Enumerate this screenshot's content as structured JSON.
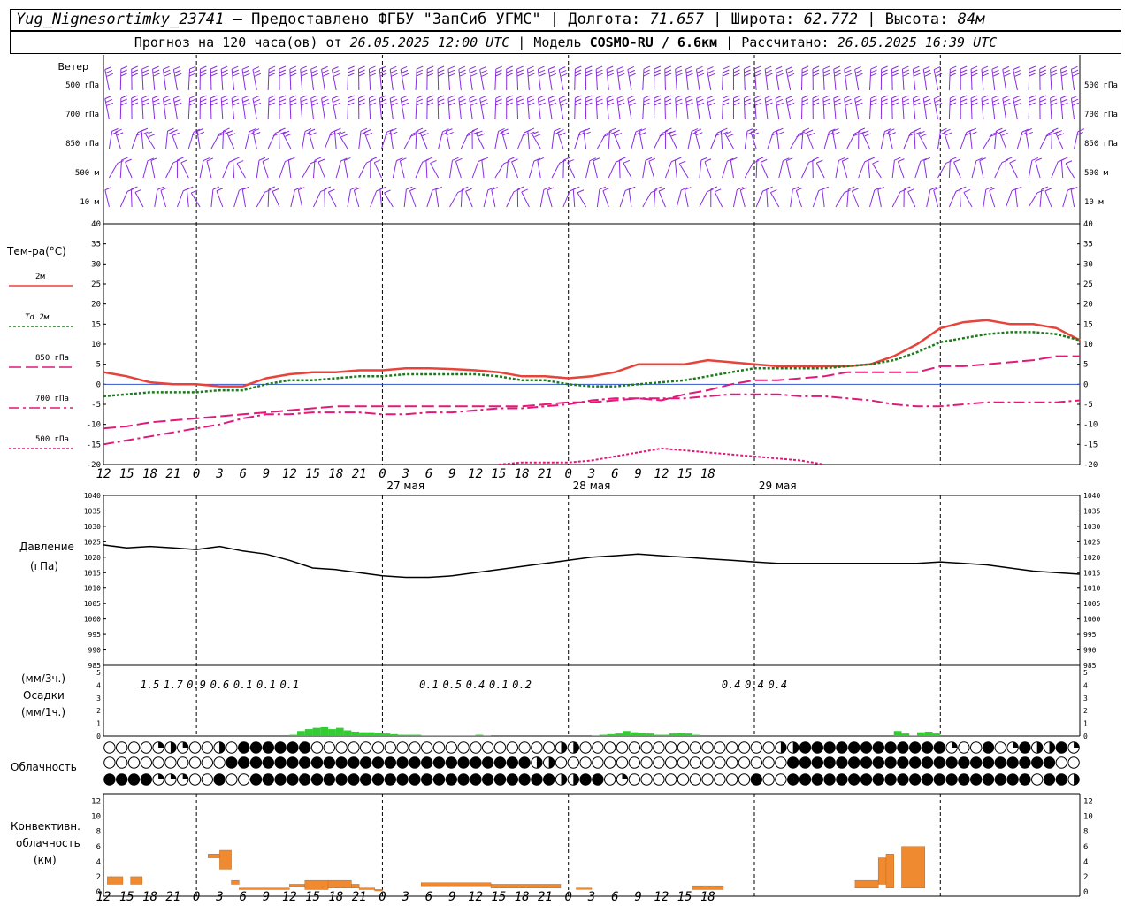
{
  "header": {
    "station": "Yug_Nignesortimky_23741",
    "provided": "– Предоставлено ФГБУ \"ЗапСиб УГМС\"",
    "lon_label": "Долгота:",
    "lon": "71.657",
    "lat_label": "Широта:",
    "lat": "62.772",
    "alt_label": "Высота:",
    "alt": "84м",
    "forecast_label": "Прогноз на 120 часа(ов) от",
    "forecast_from": "26.05.2025 12:00 UTC",
    "model_label": "Модель",
    "model": "COSMO-RU / 6.6км",
    "calc_label": "Рассчитано:",
    "calc": "26.05.2025 16:39 UTC"
  },
  "time_axis": {
    "hours": [
      "12",
      "15",
      "18",
      "21",
      "0",
      "3",
      "6",
      "9",
      "12",
      "15",
      "18",
      "21",
      "0",
      "3",
      "6",
      "9",
      "12",
      "15",
      "18",
      "21",
      "0",
      "3",
      "6",
      "9",
      "12",
      "15",
      "18"
    ],
    "days": [
      "27 мая",
      "28 мая",
      "29 мая"
    ]
  },
  "wind": {
    "label": "Ветер",
    "levels": [
      "500 гПа",
      "700 гПа",
      "850 гПа",
      "500 м",
      "10  м"
    ],
    "color": "#8a2be2"
  },
  "chart_data": [
    {
      "type": "line",
      "panel": "temperature",
      "label": "Тем-ра(°С)",
      "ylim": [
        -20,
        40
      ],
      "yticks": [
        -20,
        -15,
        -10,
        -5,
        0,
        5,
        10,
        15,
        20,
        25,
        30,
        35,
        40
      ],
      "x_hours": [
        0,
        3,
        6,
        9,
        12,
        15,
        18,
        21,
        24,
        27,
        30,
        33,
        36,
        39,
        42,
        45,
        48,
        51,
        54,
        57,
        60,
        63,
        66,
        69,
        72,
        75,
        78,
        81,
        84,
        87,
        90,
        93,
        96,
        99,
        102,
        105,
        108,
        111,
        114,
        117,
        120,
        123,
        126
      ],
      "series": [
        {
          "name": "2м",
          "color": "#e8433a",
          "style": "solid",
          "values": [
            3,
            2,
            0.5,
            0,
            0,
            -0.5,
            -0.5,
            1.5,
            2.5,
            3,
            3,
            3.5,
            3.5,
            4,
            4,
            3.8,
            3.5,
            3,
            2,
            2,
            1.5,
            2,
            3,
            5,
            5,
            5,
            6,
            5.5,
            5,
            4.5,
            4.5,
            4.5,
            4.5,
            5,
            7,
            10,
            14,
            15.5,
            16,
            15,
            15,
            14,
            11
          ]
        },
        {
          "name": "Td 2м",
          "color": "#1e7a1e",
          "style": "dotted",
          "values": [
            -3,
            -2.5,
            -2,
            -2,
            -2,
            -1.5,
            -1.5,
            0,
            1,
            1,
            1.5,
            2,
            2,
            2.5,
            2.5,
            2.5,
            2.5,
            2,
            1,
            1,
            0,
            -0.5,
            -0.5,
            0,
            0.5,
            1,
            2,
            3,
            4,
            4,
            4,
            4,
            4.5,
            5,
            6,
            8,
            10.5,
            11.5,
            12.5,
            13,
            13,
            12.5,
            11
          ]
        },
        {
          "name": "850 гПа",
          "color": "#e0197a",
          "style": "longdash",
          "values": [
            -11,
            -10.5,
            -9.5,
            -9,
            -8.5,
            -8,
            -7.5,
            -7,
            -6.5,
            -6,
            -5.5,
            -5.5,
            -5.5,
            -5.5,
            -5.5,
            -5.5,
            -5.5,
            -5.5,
            -5.5,
            -5,
            -4.5,
            -4.5,
            -4,
            -3.5,
            -4,
            -2.5,
            -1.5,
            0,
            1,
            1,
            1.5,
            2,
            3,
            3,
            3,
            3,
            4.5,
            4.5,
            5,
            5.5,
            6,
            7,
            7
          ]
        },
        {
          "name": "700 гПа",
          "color": "#e0197a",
          "style": "dashdot",
          "values": [
            -15,
            -14,
            -13,
            -12,
            -11,
            -10,
            -8.5,
            -7.5,
            -7.5,
            -7,
            -7,
            -7,
            -7.5,
            -7.5,
            -7,
            -7,
            -6.5,
            -6,
            -6,
            -5.5,
            -5,
            -4,
            -3.5,
            -3.5,
            -3.5,
            -3.5,
            -3,
            -2.5,
            -2.5,
            -2.5,
            -3,
            -3,
            -3.5,
            -4,
            -5,
            -5.5,
            -5.5,
            -5,
            -4.5,
            -4.5,
            -4.5,
            -4.5,
            -4
          ]
        },
        {
          "name": "500 гПа",
          "color": "#e0197a",
          "style": "dotted",
          "values": [
            null,
            null,
            null,
            null,
            null,
            null,
            null,
            null,
            null,
            null,
            null,
            null,
            null,
            null,
            null,
            null,
            null,
            -20,
            -19.5,
            -19.5,
            -19.5,
            -19,
            -18,
            -17,
            -16,
            -16.5,
            -17,
            -17.5,
            -18,
            -18.5,
            -19,
            -20,
            null,
            null,
            null,
            null,
            null,
            null,
            null,
            null,
            null,
            null,
            null
          ]
        }
      ]
    },
    {
      "type": "line",
      "panel": "pressure",
      "label": "Давление",
      "unit": "(гПа)",
      "ylim": [
        985,
        1040
      ],
      "yticks": [
        985,
        990,
        995,
        1000,
        1005,
        1010,
        1015,
        1020,
        1025,
        1030,
        1035,
        1040
      ],
      "x_hours": [
        0,
        3,
        6,
        9,
        12,
        15,
        18,
        21,
        24,
        27,
        30,
        33,
        36,
        39,
        42,
        45,
        48,
        51,
        54,
        57,
        60,
        63,
        66,
        69,
        72,
        75,
        78,
        81,
        84,
        87,
        90,
        93,
        96,
        99,
        102,
        105,
        108,
        111,
        114,
        117,
        120,
        123,
        126
      ],
      "series": [
        {
          "name": "",
          "color": "#000000",
          "values": [
            1024,
            1023,
            1023.5,
            1023,
            1022.5,
            1023.5,
            1022,
            1021,
            1019,
            1016.5,
            1016,
            1015,
            1014,
            1013.5,
            1013.5,
            1014,
            1015,
            1016,
            1017,
            1018,
            1019,
            1020,
            1020.5,
            1021,
            1020.5,
            1020,
            1019.5,
            1019,
            1018.5,
            1018,
            1018,
            1018,
            1018,
            1018,
            1018,
            1018,
            1018.5,
            1018,
            1017.5,
            1016.5,
            1015.5,
            1015,
            1014.5
          ]
        }
      ]
    },
    {
      "type": "bar",
      "panel": "precipitation",
      "label": "Осадки",
      "units_top": "(мм/3ч.)",
      "units_bottom": "(мм/1ч.)",
      "ylim": [
        0,
        5
      ],
      "yticks": [
        0,
        1,
        2,
        3,
        4,
        5
      ],
      "color": "#33cc33",
      "x_hours": [
        24,
        25,
        26,
        27,
        28,
        29,
        30,
        31,
        32,
        33,
        34,
        35,
        36,
        37,
        38,
        39,
        40,
        41,
        42,
        43,
        44,
        45,
        46,
        47,
        48,
        49,
        63,
        64,
        65,
        66,
        67,
        68,
        69,
        70,
        71,
        72,
        73,
        74,
        75,
        76,
        102,
        103,
        104,
        105,
        106,
        107
      ],
      "values": [
        0.1,
        0.4,
        0.55,
        0.65,
        0.7,
        0.55,
        0.65,
        0.45,
        0.35,
        0.3,
        0.3,
        0.25,
        0.2,
        0.15,
        0.1,
        0.1,
        0.1,
        0.05,
        0.05,
        0.05,
        0.05,
        0.05,
        0.05,
        0.05,
        0.1,
        0.05,
        0.05,
        0.1,
        0.15,
        0.2,
        0.4,
        0.3,
        0.25,
        0.2,
        0.1,
        0.1,
        0.2,
        0.25,
        0.2,
        0.1,
        0.4,
        0.2,
        0.05,
        0.3,
        0.35,
        0.2
      ],
      "annotations": [
        "1.5",
        "1.7",
        "0.9",
        "0.6",
        "0.1",
        "0.1",
        "0.1",
        "0.1",
        "0.5",
        "0.4",
        "0.1",
        "0.2",
        "0.4",
        "0.4",
        "0.4"
      ],
      "annotation_hours": [
        6,
        9,
        12,
        15,
        18,
        21,
        24,
        42,
        45,
        48,
        51,
        54,
        81,
        84,
        87
      ]
    },
    {
      "type": "bar",
      "panel": "convective_clouds",
      "label": "Конвективн. облачность (км)",
      "ylim": [
        0,
        13
      ],
      "yticks": [
        0,
        2,
        4,
        6,
        8,
        10,
        12
      ],
      "color": "#f08a30",
      "bars": [
        {
          "x0": 0.5,
          "x1": 2.5,
          "lo": 1,
          "hi": 2
        },
        {
          "x0": 3.5,
          "x1": 5,
          "lo": 1,
          "hi": 2
        },
        {
          "x0": 13.5,
          "x1": 15,
          "lo": 4.5,
          "hi": 5
        },
        {
          "x0": 15,
          "x1": 16.5,
          "lo": 3,
          "hi": 5.5
        },
        {
          "x0": 16.5,
          "x1": 17.5,
          "lo": 1,
          "hi": 1.5
        },
        {
          "x0": 17.5,
          "x1": 24,
          "lo": 0.3,
          "hi": 0.5
        },
        {
          "x0": 24,
          "x1": 26,
          "lo": 0.7,
          "hi": 1
        },
        {
          "x0": 26,
          "x1": 29,
          "lo": 0.3,
          "hi": 1.5
        },
        {
          "x0": 29,
          "x1": 32,
          "lo": 0.5,
          "hi": 1.5
        },
        {
          "x0": 32,
          "x1": 33,
          "lo": 0.5,
          "hi": 1
        },
        {
          "x0": 33,
          "x1": 35,
          "lo": 0.3,
          "hi": 0.5
        },
        {
          "x0": 35,
          "x1": 36,
          "lo": 0.3,
          "hi": 0.3
        },
        {
          "x0": 41,
          "x1": 50,
          "lo": 0.8,
          "hi": 1.2
        },
        {
          "x0": 50,
          "x1": 59,
          "lo": 0.5,
          "hi": 1
        },
        {
          "x0": 61,
          "x1": 63,
          "lo": 0.5,
          "hi": 0.5
        },
        {
          "x0": 76,
          "x1": 80,
          "lo": 0.3,
          "hi": 0.8
        },
        {
          "x0": 97,
          "x1": 100,
          "lo": 0.5,
          "hi": 1.5
        },
        {
          "x0": 100,
          "x1": 101,
          "lo": 1,
          "hi": 4.5
        },
        {
          "x0": 101,
          "x1": 102,
          "lo": 0.5,
          "hi": 5
        },
        {
          "x0": 103,
          "x1": 106,
          "lo": 0.5,
          "hi": 6
        }
      ]
    }
  ],
  "clouds": {
    "label": "Облачность",
    "rows": 3
  }
}
